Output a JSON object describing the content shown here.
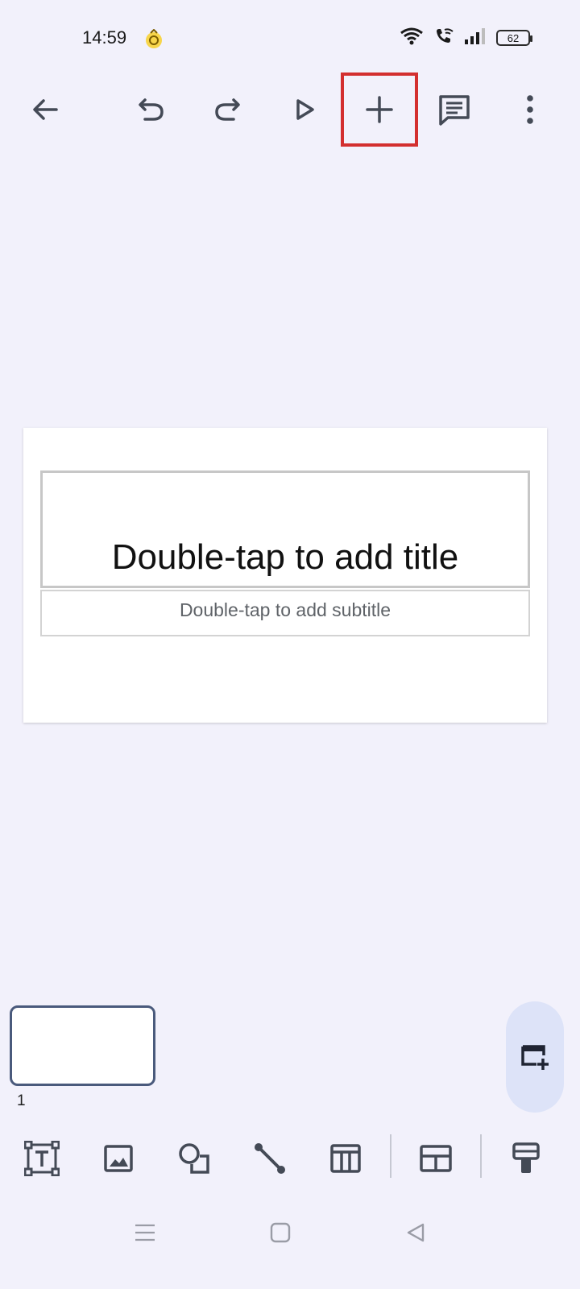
{
  "status_bar": {
    "time": "14:59",
    "battery": "62"
  },
  "toolbar": {
    "icons": [
      "back-arrow-icon",
      "undo-icon",
      "redo-icon",
      "play-icon",
      "plus-icon",
      "comment-icon",
      "more-vert-icon"
    ],
    "highlight_color": "#d32f2f"
  },
  "slide": {
    "title_placeholder": "Double-tap to add title",
    "subtitle_placeholder": "Double-tap to add subtitle"
  },
  "filmstrip": {
    "slides": [
      {
        "number": "1"
      }
    ]
  },
  "insert_bar": {
    "icons": [
      "text-box-icon",
      "image-icon",
      "shape-icon",
      "line-icon",
      "table-icon",
      "layout-icon",
      "format-paint-icon"
    ]
  },
  "colors": {
    "background": "#f2f1fb",
    "fab": "#dde3f8",
    "icon": "#444a56"
  }
}
